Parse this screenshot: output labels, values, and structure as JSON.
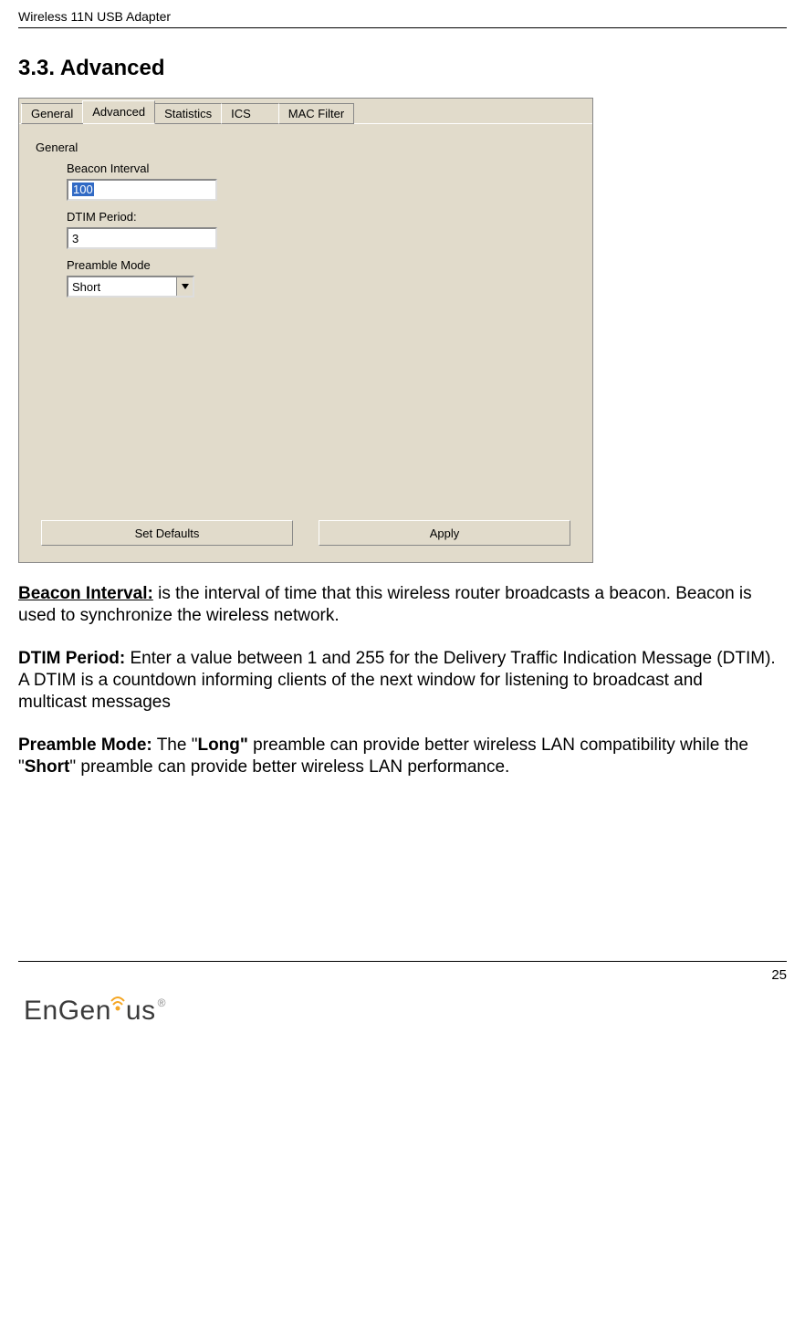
{
  "header": {
    "title": "Wireless 11N USB Adapter"
  },
  "section": {
    "number": "3.3.",
    "title": "Advanced"
  },
  "app": {
    "tabs": [
      "General",
      "Advanced",
      "Statistics",
      "ICS",
      "MAC Filter"
    ],
    "active_tab_index": 1,
    "group_label": "General",
    "fields": {
      "beacon_interval": {
        "label": "Beacon Interval",
        "value": "100"
      },
      "dtim_period": {
        "label": "DTIM Period:",
        "value": "3"
      },
      "preamble_mode": {
        "label": "Preamble Mode",
        "value": "Short"
      }
    },
    "buttons": {
      "set_defaults": "Set Defaults",
      "apply": "Apply"
    }
  },
  "doc": {
    "p1": {
      "label": "Beacon Interval:",
      "text": " is the interval of time that this wireless router broadcasts a beacon. Beacon is used to synchronize the wireless network."
    },
    "p2": {
      "label": "DTIM Period:",
      "text": " Enter a value between 1 and 255 for the Delivery Traffic Indication Message (DTIM). A DTIM is a countdown informing clients of the next window for listening to broadcast and multicast messages"
    },
    "p3": {
      "label": "Preamble Mode:",
      "lead": " The \"",
      "long_word": "Long\"",
      "mid": " preamble can provide better wireless LAN compatibility while the \"",
      "short_word": "Short",
      "tail": "\" preamble can provide better wireless LAN performance."
    }
  },
  "footer": {
    "page_number": "25",
    "logo_text_a": "EnGen",
    "logo_text_b": "us"
  }
}
